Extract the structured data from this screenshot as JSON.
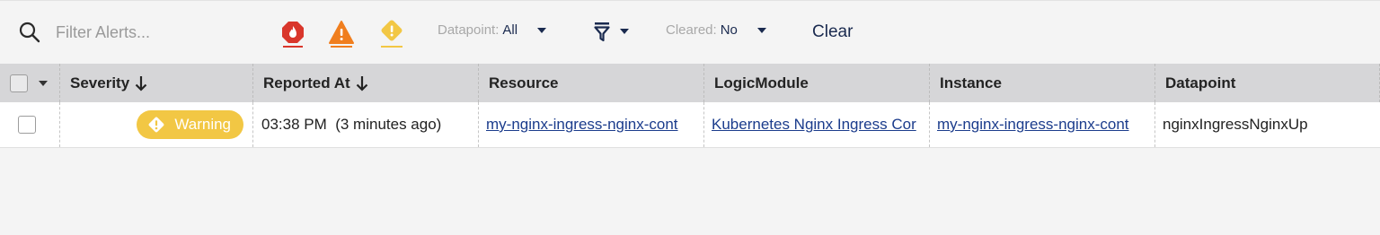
{
  "toolbar": {
    "filter_placeholder": "Filter Alerts...",
    "severity_filters": [
      "critical-icon",
      "error-icon",
      "warning-icon"
    ],
    "datapoint_label": "Datapoint:",
    "datapoint_value": "All",
    "cleared_label": "Cleared:",
    "cleared_value": "No",
    "clear_label": "Clear"
  },
  "table": {
    "columns": [
      "Severity",
      "Reported At",
      "Resource",
      "LogicModule",
      "Instance",
      "Datapoint"
    ],
    "rows": [
      {
        "severity": "Warning",
        "reported_at": "03:38 PM  (3 minutes ago)",
        "resource": "my-nginx-ingress-nginx-cont",
        "logic_module": "Kubernetes Nginx Ingress Cor",
        "instance": "my-nginx-ingress-nginx-cont",
        "datapoint": "nginxIngressNginxUp"
      }
    ]
  },
  "colors": {
    "critical": "#d9362b",
    "error": "#f07e1e",
    "warning": "#f2c744",
    "link": "#1b3c8c",
    "header_bg": "#d6d6d8"
  }
}
